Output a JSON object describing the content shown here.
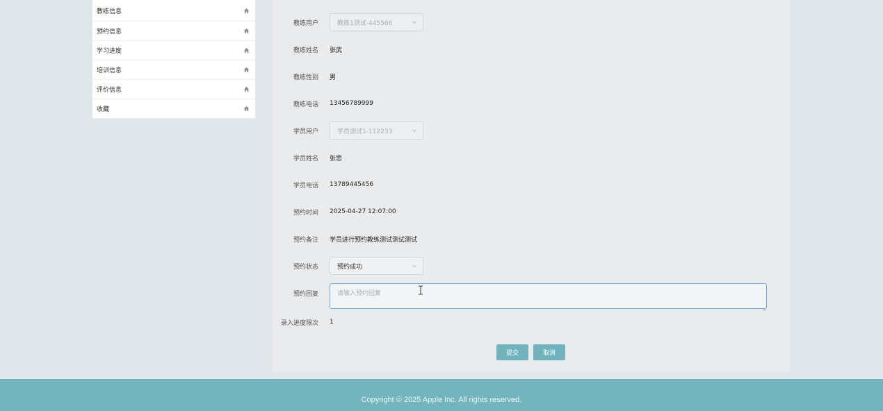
{
  "sidebar": {
    "items": [
      {
        "label": "教练信息",
        "icon": "home-icon"
      },
      {
        "label": "预约信息",
        "icon": "home-icon"
      },
      {
        "label": "学习进度",
        "icon": "home-icon"
      },
      {
        "label": "培训信息",
        "icon": "home-icon"
      },
      {
        "label": "评价信息",
        "icon": "home-icon"
      },
      {
        "label": "收藏",
        "icon": "home-icon"
      }
    ]
  },
  "form": {
    "coach_user": {
      "label": "教练用户",
      "value": "教练1测试-445566"
    },
    "coach_name": {
      "label": "教练姓名",
      "value": "张武"
    },
    "coach_gender": {
      "label": "教练性别",
      "value": "男"
    },
    "coach_phone": {
      "label": "教练电话",
      "value": "13456789999"
    },
    "student_user": {
      "label": "学员用户",
      "value": "学员测试1-112233"
    },
    "student_name": {
      "label": "学员姓名",
      "value": "张思"
    },
    "student_phone": {
      "label": "学员电话",
      "value": "13789445456"
    },
    "booking_time": {
      "label": "预约时间",
      "value": "2025-04-27 12:07:00"
    },
    "booking_note": {
      "label": "预约备注",
      "value": "学员进行预约教练测试测试测试"
    },
    "booking_status": {
      "label": "预约状态",
      "value": "预约成功"
    },
    "booking_reply": {
      "label": "预约回复",
      "placeholder": "请输入预约回复"
    },
    "progress_count": {
      "label": "录入进度限次",
      "value": "1"
    },
    "submit_label": "提交",
    "cancel_label": "取消"
  },
  "footer": {
    "copyright": "Copyright © 2025 Apple Inc. All rights reserved."
  },
  "colors": {
    "accent": "#6fb3bc",
    "footer_bg": "#73b5bd",
    "page_bg": "#dfe7ea",
    "panel_bg": "#eaebec",
    "focus_border": "#6fa8dc"
  }
}
